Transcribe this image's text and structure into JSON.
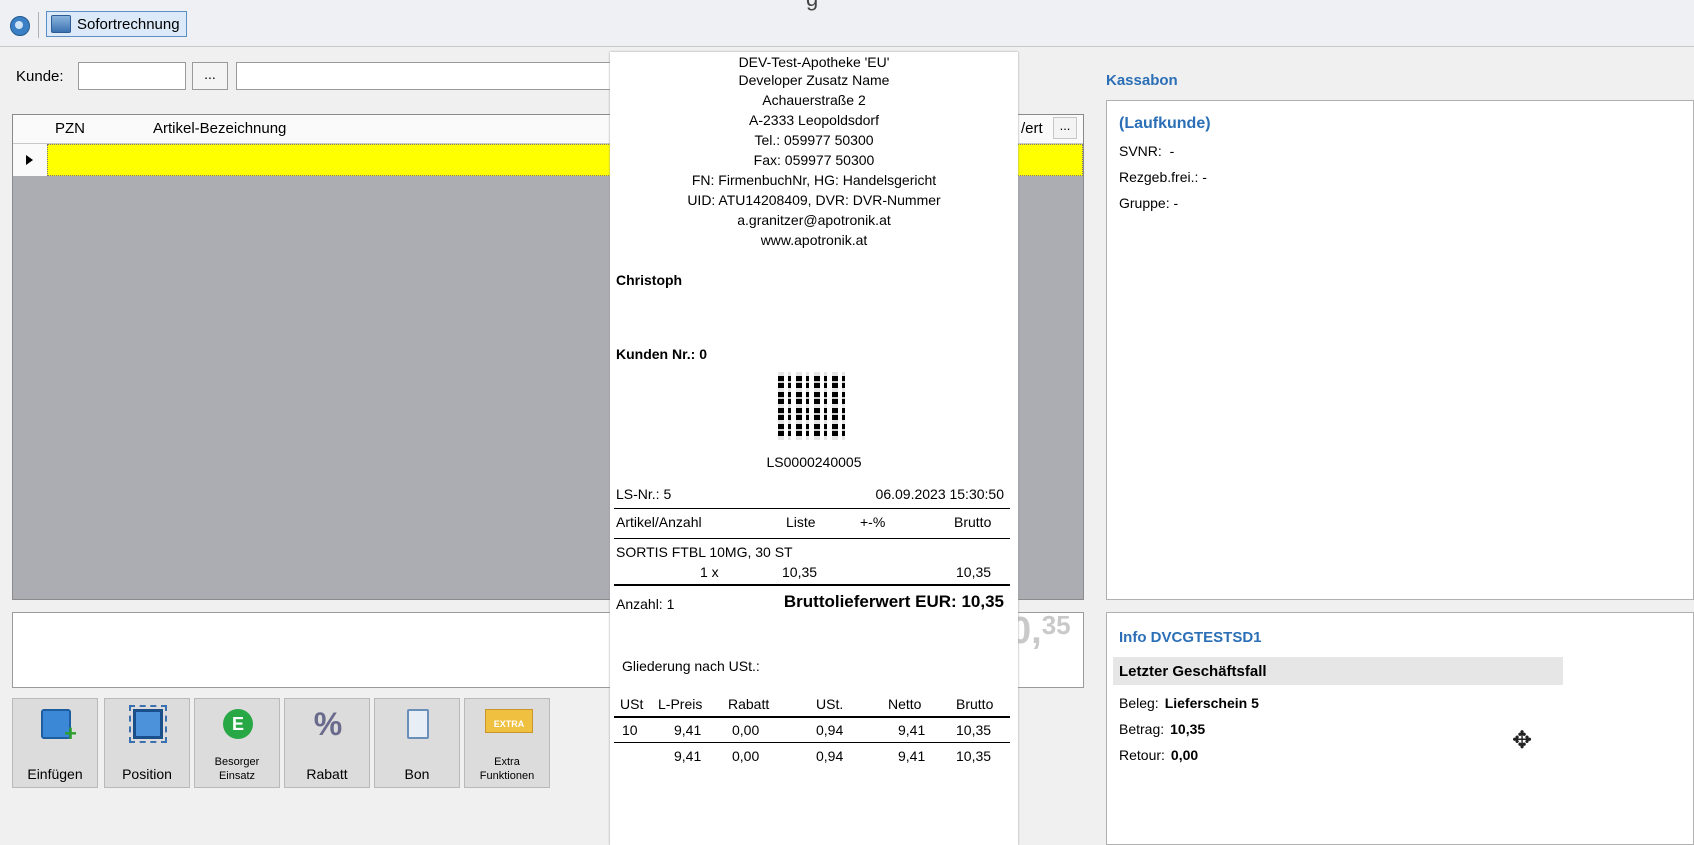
{
  "toolbar": {
    "title_fragment": "g",
    "sofortrechnung_label": "Sofortrechnung"
  },
  "kunde": {
    "label": "Kunde:",
    "lookup_button": "...",
    "number_value": "",
    "name_value": ""
  },
  "grid": {
    "columns": [
      "PZN",
      "Artikel-Bezeichnung",
      "/ert"
    ],
    "more_button": "..."
  },
  "big_total": {
    "main": "0,",
    "superscript": "35"
  },
  "buttons": [
    {
      "label": "Einfügen",
      "icon": "insert-icon"
    },
    {
      "label": "Position",
      "icon": "position-icon"
    },
    {
      "label": "Besorger Einsatz",
      "line1": "Besorger",
      "line2": "Einsatz",
      "icon": "besorger-icon",
      "icon_text": "E"
    },
    {
      "label": "Rabatt",
      "icon": "percent-icon",
      "icon_text": "%"
    },
    {
      "label": "Bon",
      "icon": "receipt-icon"
    },
    {
      "label": "Extra Funktionen",
      "line1": "Extra",
      "line2": "Funktionen",
      "icon": "extra-icon",
      "icon_text": "EXTRA"
    }
  ],
  "kassabon": {
    "title": "Kassabon",
    "customer": "(Laufkunde)",
    "svnr_label": "SVNR:",
    "svnr_value": "-",
    "rezgeb_label": "Rezgeb.frei.:",
    "rezgeb_value": "-",
    "gruppe_label": "Gruppe:",
    "gruppe_value": "-"
  },
  "info": {
    "title": "Info DVCGTESTSD1",
    "band": "Letzter Geschäftsfall",
    "beleg_label": "Beleg:",
    "beleg_value": "Lieferschein 5",
    "betrag_label": "Betrag:",
    "betrag_value": "10,35",
    "retour_label": "Retour:",
    "retour_value": "0,00"
  },
  "receipt": {
    "header": [
      "DEV-Test-Apotheke 'EU'",
      "Developer Zusatz Name",
      "Achauerstraße 2",
      "A-2333 Leopoldsdorf",
      "Tel.: 059977 50300",
      "Fax: 059977 50300",
      "FN: FirmenbuchNr, HG: Handelsgericht",
      "UID: ATU14208409, DVR: DVR-Nummer",
      "a.granitzer@apotronik.at",
      "www.apotronik.at"
    ],
    "name": "Christoph",
    "kunden_nr": "Kunden Nr.: 0",
    "ls_code": "LS0000240005",
    "ls_nr": "LS-Nr.: 5",
    "datetime": "06.09.2023 15:30:50",
    "item_header": {
      "artikel": "Artikel/Anzahl",
      "liste": "Liste",
      "pct": "+-%",
      "brutto": "Brutto"
    },
    "item_name": "SORTIS FTBL 10MG, 30 ST",
    "item_qty": "1 x",
    "item_liste": "10,35",
    "item_brutto": "10,35",
    "anzahl": "Anzahl: 1",
    "brutto_total": "Bruttolieferwert EUR: 10,35",
    "gliederung": "Gliederung nach USt.:",
    "tax_header": [
      "USt",
      "L-Preis",
      "Rabatt",
      "USt.",
      "Netto",
      "Brutto"
    ],
    "tax_row": [
      "10",
      "9,41",
      "0,00",
      "0,94",
      "9,41",
      "10,35"
    ],
    "tax_sum": [
      "",
      "9,41",
      "0,00",
      "0,94",
      "9,41",
      "10,35"
    ]
  }
}
